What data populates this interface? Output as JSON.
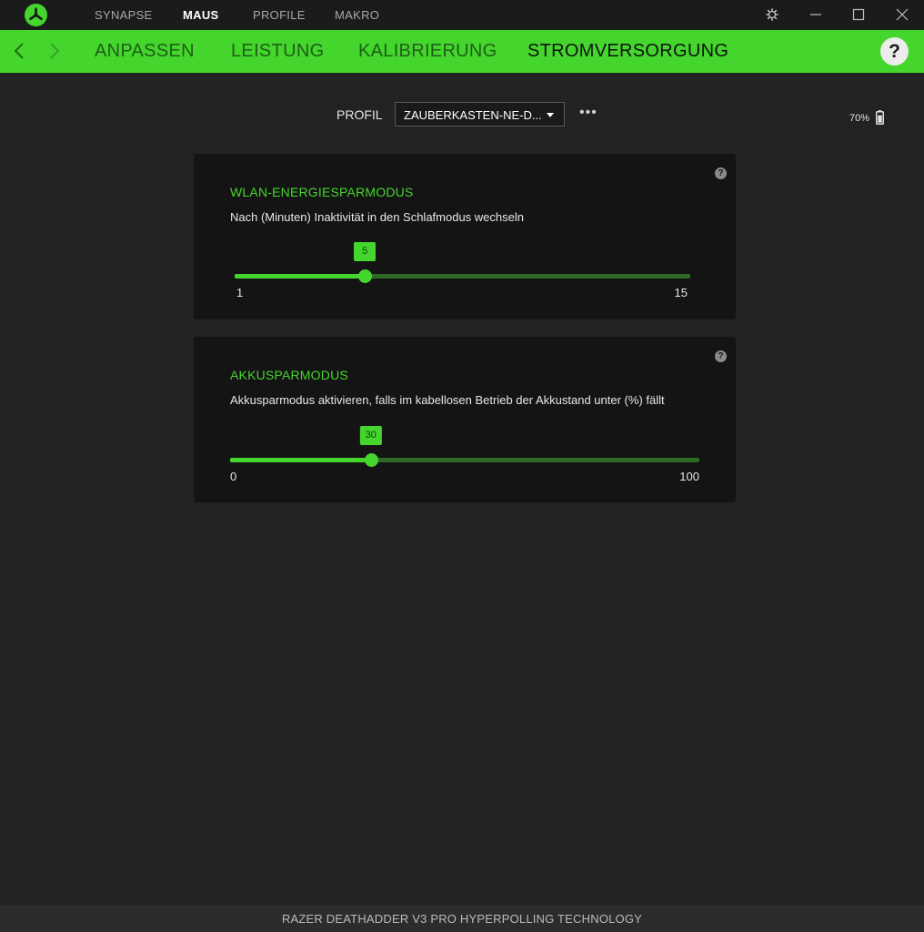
{
  "topnav": {
    "items": [
      {
        "label": "SYNAPSE",
        "active": false
      },
      {
        "label": "MAUS",
        "active": true
      },
      {
        "label": "PROFILE",
        "active": false
      },
      {
        "label": "MAKRO",
        "active": false
      }
    ]
  },
  "window_controls": [
    "gear-icon",
    "minimize-icon",
    "maximize-icon",
    "close-icon"
  ],
  "subnav": {
    "tabs": [
      {
        "label": "ANPASSEN",
        "active": false
      },
      {
        "label": "LEISTUNG",
        "active": false
      },
      {
        "label": "KALIBRIERUNG",
        "active": false
      },
      {
        "label": "STROMVERSORGUNG",
        "active": true
      }
    ],
    "help_label": "?"
  },
  "profile": {
    "label": "PROFIL",
    "selected": "ZAUBERKASTEN-NE-D...",
    "more_label": "•••"
  },
  "battery": {
    "percent_label": "70%",
    "level": 0.7
  },
  "panels": [
    {
      "title": "WLAN-ENERGIESPARMODUS",
      "description": "Nach (Minuten) Inaktivität in den Schlafmodus wechseln",
      "slider": {
        "min": 1,
        "max": 15,
        "value": 5,
        "min_label": "1",
        "max_label": "15",
        "value_label": "5"
      },
      "help_label": "?"
    },
    {
      "title": "AKKUSPARMODUS",
      "description": "Akkusparmodus aktivieren, falls im kabellosen Betrieb der Akkustand unter (%) fällt",
      "slider": {
        "min": 0,
        "max": 100,
        "value": 30,
        "min_label": "0",
        "max_label": "100",
        "value_label": "30"
      },
      "help_label": "?"
    }
  ],
  "footer": {
    "device_name": "RAZER DEATHADDER V3 PRO HYPERPOLLING TECHNOLOGY"
  },
  "colors": {
    "accent": "#44d62c",
    "track": "#2e6b25",
    "background": "#222222",
    "panel": "#141414"
  }
}
